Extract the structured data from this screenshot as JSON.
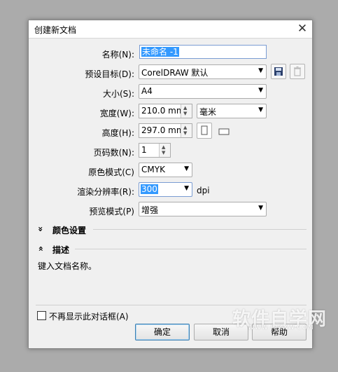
{
  "dialog": {
    "title": "创建新文档",
    "close_glyph": "✕"
  },
  "form": {
    "name": {
      "label": "名称(N):",
      "value": "未命名 -1"
    },
    "preset": {
      "label": "预设目标(D):",
      "value": "CorelDRAW 默认"
    },
    "size": {
      "label": "大小(S):",
      "value": "A4"
    },
    "width": {
      "label": "宽度(W):",
      "value": "210.0 mm",
      "unit": "毫米"
    },
    "height": {
      "label": "高度(H):",
      "value": "297.0 mm"
    },
    "pages": {
      "label": "页码数(N):",
      "value": "1"
    },
    "color_mode": {
      "label": "原色模式(C)",
      "value": "CMYK"
    },
    "resolution": {
      "label": "渲染分辨率(R):",
      "value": "300",
      "unit": "dpi"
    },
    "preview": {
      "label": "预览模式(P)",
      "value": "增强"
    }
  },
  "sections": {
    "color_settings": {
      "glyph": "»",
      "label": "颜色设置"
    },
    "description": {
      "glyph": "»",
      "label": "描述",
      "text": "键入文档名称。"
    }
  },
  "footer": {
    "dont_show_label": "不再显示此对话框(A)",
    "dont_show_checked": false,
    "ok": "确定",
    "cancel": "取消",
    "help": "帮助"
  },
  "watermark": {
    "text": "软件自学网",
    "url": "WWW.RJZXW.COM"
  }
}
